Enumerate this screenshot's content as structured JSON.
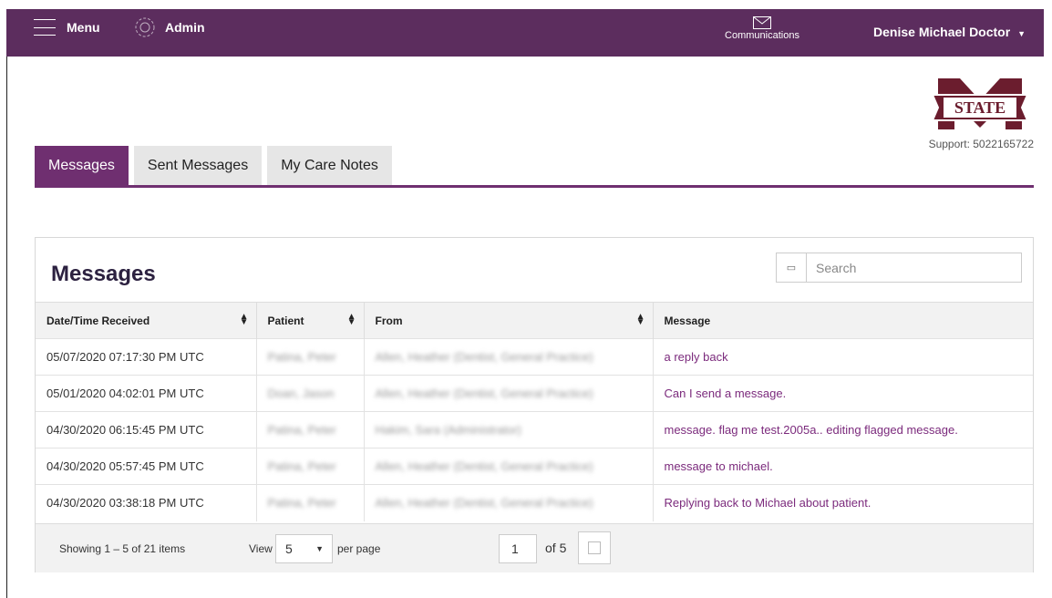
{
  "topbar": {
    "menu_label": "Menu",
    "admin_label": "Admin",
    "communications_label": "Communications",
    "user_name": "Denise Michael Doctor",
    "background": "#5c2d5e"
  },
  "branding": {
    "logo_text": "STATE",
    "support": "Support: 5022165722"
  },
  "tabs": [
    {
      "label": "Messages",
      "active": true
    },
    {
      "label": "Sent Messages",
      "active": false
    },
    {
      "label": "My Care Notes",
      "active": false
    }
  ],
  "panel": {
    "title": "Messages",
    "search_placeholder": "Search",
    "columns": [
      "Date/Time Received",
      "Patient",
      "From",
      "Message"
    ],
    "rows": [
      {
        "date": "05/07/2020 07:17:30 PM UTC",
        "patient": "Patina, Peter",
        "from": "Allen, Heather (Dentist, General Practice)",
        "message": "a reply back"
      },
      {
        "date": "05/01/2020 04:02:01 PM UTC",
        "patient": "Doan, Jason",
        "from": "Allen, Heather (Dentist, General Practice)",
        "message": "Can I send a message."
      },
      {
        "date": "04/30/2020 06:15:45 PM UTC",
        "patient": "Patina, Peter",
        "from": "Hakim, Sara (Administrator)",
        "message": "message. flag me test.2005a.. editing flagged message."
      },
      {
        "date": "04/30/2020 05:57:45 PM UTC",
        "patient": "Patina, Peter",
        "from": "Allen, Heather (Dentist, General Practice)",
        "message": "message to michael."
      },
      {
        "date": "04/30/2020 03:38:18 PM UTC",
        "patient": "Patina, Peter",
        "from": "Allen, Heather (Dentist, General Practice)",
        "message": "Replying back to Michael about patient."
      }
    ],
    "pager": {
      "showing": "Showing 1 – 5 of 21 items",
      "view_label": "View",
      "page_size": "5",
      "per_page_label": "per page",
      "current_page": "1",
      "of_pages": "of 5"
    }
  },
  "colors": {
    "accent": "#6f2f70",
    "link": "#7b2a7c"
  }
}
